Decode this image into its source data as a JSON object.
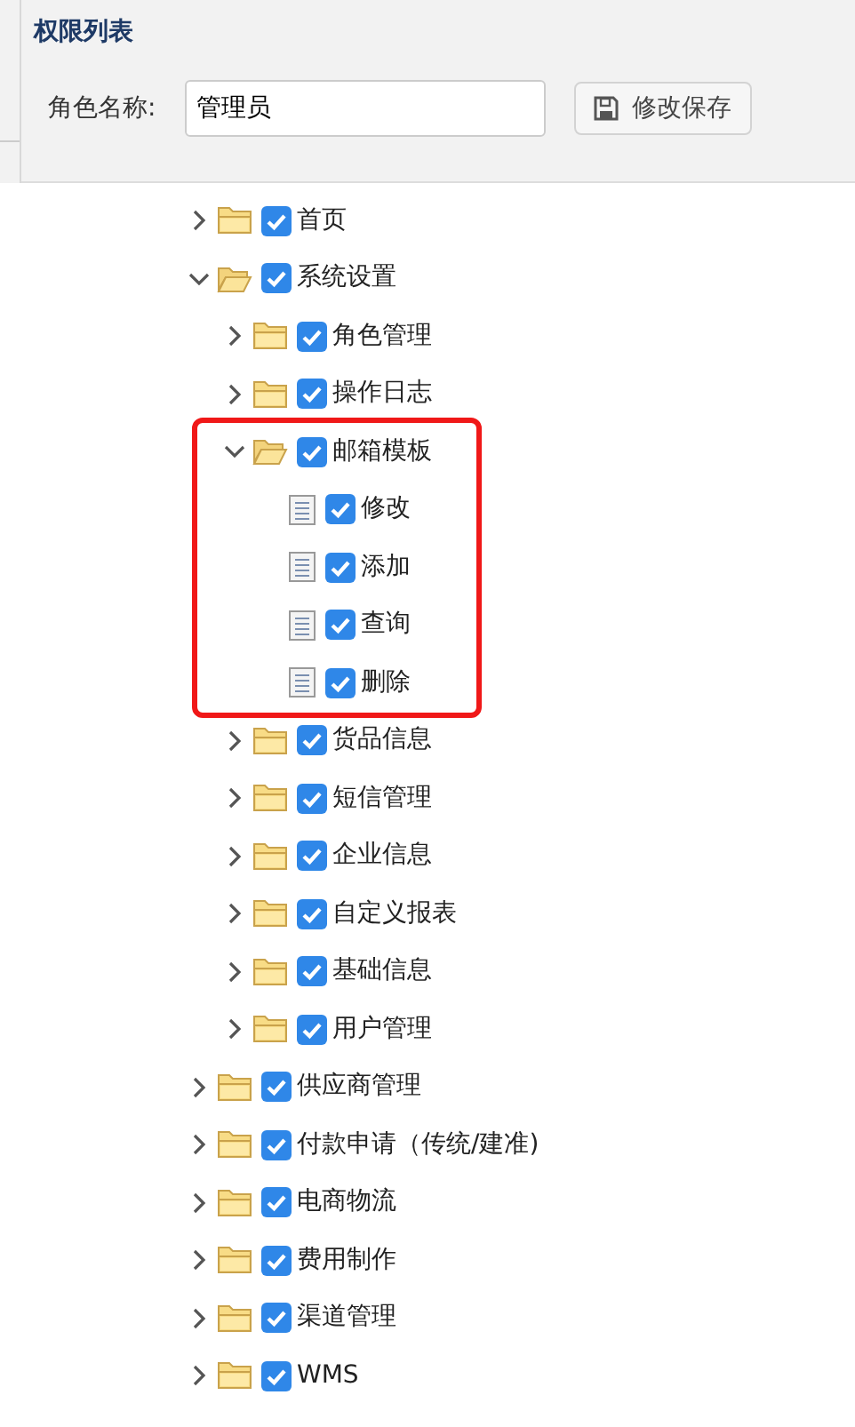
{
  "panel": {
    "title": "权限列表",
    "role_label": "角色名称:",
    "role_value": "管理员",
    "save_button": "修改保存"
  },
  "tree": [
    {
      "label": "首页",
      "kind": "folder",
      "expanded": false,
      "checked": true
    },
    {
      "label": "系统设置",
      "kind": "folder",
      "expanded": true,
      "checked": true,
      "children": [
        {
          "label": "角色管理",
          "kind": "folder",
          "expanded": false,
          "checked": true
        },
        {
          "label": "操作日志",
          "kind": "folder",
          "expanded": false,
          "checked": true
        },
        {
          "label": "邮箱模板",
          "kind": "folder",
          "expanded": true,
          "checked": true,
          "highlighted": true,
          "children": [
            {
              "label": "修改",
              "kind": "leaf",
              "checked": true
            },
            {
              "label": "添加",
              "kind": "leaf",
              "checked": true
            },
            {
              "label": "查询",
              "kind": "leaf",
              "checked": true
            },
            {
              "label": "删除",
              "kind": "leaf",
              "checked": true
            }
          ]
        },
        {
          "label": "货品信息",
          "kind": "folder",
          "expanded": false,
          "checked": true
        },
        {
          "label": "短信管理",
          "kind": "folder",
          "expanded": false,
          "checked": true
        },
        {
          "label": "企业信息",
          "kind": "folder",
          "expanded": false,
          "checked": true
        },
        {
          "label": "自定义报表",
          "kind": "folder",
          "expanded": false,
          "checked": true
        },
        {
          "label": "基础信息",
          "kind": "folder",
          "expanded": false,
          "checked": true
        },
        {
          "label": "用户管理",
          "kind": "folder",
          "expanded": false,
          "checked": true
        }
      ]
    },
    {
      "label": "供应商管理",
      "kind": "folder",
      "expanded": false,
      "checked": true
    },
    {
      "label": "付款申请（传统/建准)",
      "kind": "folder",
      "expanded": false,
      "checked": true
    },
    {
      "label": "电商物流",
      "kind": "folder",
      "expanded": false,
      "checked": true
    },
    {
      "label": "费用制作",
      "kind": "folder",
      "expanded": false,
      "checked": true
    },
    {
      "label": "渠道管理",
      "kind": "folder",
      "expanded": false,
      "checked": true
    },
    {
      "label": "WMS",
      "kind": "folder",
      "expanded": false,
      "checked": true
    }
  ]
}
